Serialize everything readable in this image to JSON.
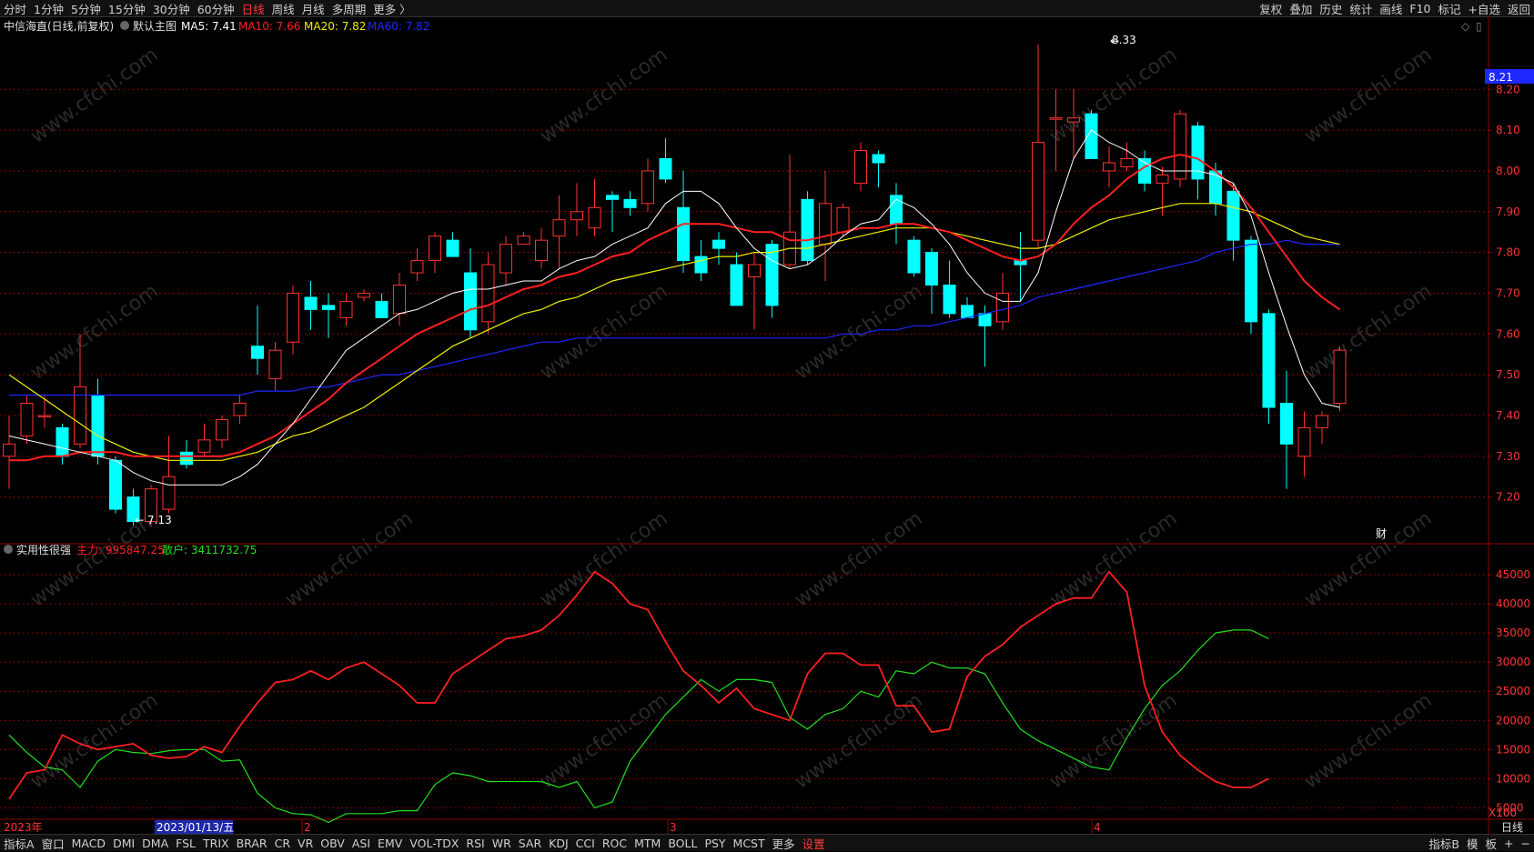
{
  "topbar": {
    "periods": [
      "分时",
      "1分钟",
      "5分钟",
      "15分钟",
      "30分钟",
      "60分钟",
      "日线",
      "周线",
      "月线",
      "多周期",
      "更多 〉"
    ],
    "active_period": "日线",
    "tools": [
      "复权",
      "叠加",
      "历史",
      "统计",
      "画线",
      "F10",
      "标记",
      "+自选",
      "返回"
    ]
  },
  "main_chart": {
    "title": "中信海直(日线,前复权)",
    "template": "默认主图",
    "ma5": "MA5: 7.41",
    "ma10": "MA10: 7.66",
    "ma20": "MA20: 7.82",
    "ma60": "MA60: 7.82",
    "current_price_tag": "8.21",
    "high_label": "8.33",
    "low_label": "7.13",
    "fin_badge": "财"
  },
  "sub_chart": {
    "title": "实用性很强",
    "zhuli": "主力: 995847.25",
    "sanhu": "散户: 3411732.75",
    "unit": "X100"
  },
  "time_axis": {
    "labels": [
      "2023年",
      "2023/01/13/五",
      "2",
      "3",
      "4"
    ],
    "period_label": "日线"
  },
  "botbar": {
    "indicators": [
      "指标A",
      "窗口",
      "MACD",
      "DMI",
      "DMA",
      "FSL",
      "TRIX",
      "BRAR",
      "CR",
      "VR",
      "OBV",
      "ASI",
      "EMV",
      "VOL-TDX",
      "RSI",
      "WR",
      "SAR",
      "KDJ",
      "CCI",
      "ROC",
      "MTM",
      "BOLL",
      "PSY",
      "MCST",
      "更多",
      "设置"
    ],
    "right": [
      "指标B",
      "模",
      "板",
      "+",
      "−"
    ]
  },
  "watermark": "www.cfchi.com",
  "colors": {
    "up": "#ff3232",
    "down": "#00ffff",
    "ma5": "#ffffff",
    "ma10": "#ff2020",
    "ma20": "#f0f000",
    "ma60": "#1e28ff",
    "zhuli": "#ff2020",
    "sanhu": "#20e020",
    "grid": "#8b0000"
  },
  "chart_data": [
    {
      "type": "candlestick",
      "title": "中信海直(日线,前复权)",
      "ylim": [
        7.13,
        8.33
      ],
      "yticks": [
        7.2,
        7.3,
        7.4,
        7.5,
        7.6,
        7.7,
        7.8,
        7.9,
        8.0,
        8.1,
        8.2
      ],
      "ohlc": [
        [
          7.3,
          7.33,
          7.22,
          7.4
        ],
        [
          7.35,
          7.43,
          7.33,
          7.45
        ],
        [
          7.4,
          7.4,
          7.37,
          7.45
        ],
        [
          7.37,
          7.3,
          7.28,
          7.38
        ],
        [
          7.33,
          7.47,
          7.32,
          7.6
        ],
        [
          7.45,
          7.3,
          7.28,
          7.49
        ],
        [
          7.29,
          7.17,
          7.16,
          7.3
        ],
        [
          7.2,
          7.14,
          7.13,
          7.22
        ],
        [
          7.14,
          7.22,
          7.13,
          7.23
        ],
        [
          7.17,
          7.25,
          7.16,
          7.35
        ],
        [
          7.31,
          7.28,
          7.27,
          7.34
        ],
        [
          7.31,
          7.34,
          7.3,
          7.38
        ],
        [
          7.34,
          7.39,
          7.32,
          7.4
        ],
        [
          7.4,
          7.43,
          7.38,
          7.45
        ],
        [
          7.57,
          7.54,
          7.5,
          7.67
        ],
        [
          7.49,
          7.56,
          7.46,
          7.58
        ],
        [
          7.58,
          7.7,
          7.55,
          7.72
        ],
        [
          7.69,
          7.66,
          7.61,
          7.73
        ],
        [
          7.67,
          7.66,
          7.59,
          7.7
        ],
        [
          7.64,
          7.68,
          7.62,
          7.7
        ],
        [
          7.69,
          7.7,
          7.68,
          7.71
        ],
        [
          7.68,
          7.64,
          7.64,
          7.7
        ],
        [
          7.65,
          7.72,
          7.62,
          7.75
        ],
        [
          7.75,
          7.78,
          7.73,
          7.81
        ],
        [
          7.78,
          7.84,
          7.75,
          7.85
        ],
        [
          7.83,
          7.79,
          7.79,
          7.85
        ],
        [
          7.75,
          7.61,
          7.59,
          7.81
        ],
        [
          7.63,
          7.77,
          7.6,
          7.8
        ],
        [
          7.75,
          7.82,
          7.72,
          7.84
        ],
        [
          7.82,
          7.84,
          7.82,
          7.85
        ],
        [
          7.78,
          7.83,
          7.76,
          7.86
        ],
        [
          7.84,
          7.88,
          7.76,
          7.94
        ],
        [
          7.88,
          7.9,
          7.84,
          7.97
        ],
        [
          7.86,
          7.91,
          7.84,
          7.98
        ],
        [
          7.94,
          7.93,
          7.85,
          7.95
        ],
        [
          7.93,
          7.91,
          7.89,
          7.95
        ],
        [
          7.92,
          8.0,
          7.9,
          8.03
        ],
        [
          8.03,
          7.98,
          7.97,
          8.08
        ],
        [
          7.91,
          7.78,
          7.75,
          8.0
        ],
        [
          7.79,
          7.75,
          7.73,
          7.83
        ],
        [
          7.83,
          7.81,
          7.77,
          7.85
        ],
        [
          7.77,
          7.67,
          7.67,
          7.8
        ],
        [
          7.74,
          7.77,
          7.61,
          7.8
        ],
        [
          7.82,
          7.67,
          7.64,
          7.83
        ],
        [
          7.77,
          7.85,
          7.76,
          8.04
        ],
        [
          7.93,
          7.78,
          7.77,
          7.95
        ],
        [
          7.82,
          7.92,
          7.73,
          8.0
        ],
        [
          7.85,
          7.91,
          7.84,
          7.92
        ],
        [
          7.97,
          8.05,
          7.95,
          8.07
        ],
        [
          8.04,
          8.02,
          7.96,
          8.05
        ],
        [
          7.94,
          7.87,
          7.82,
          7.97
        ],
        [
          7.83,
          7.75,
          7.74,
          7.84
        ],
        [
          7.8,
          7.72,
          7.65,
          7.81
        ],
        [
          7.72,
          7.65,
          7.64,
          7.78
        ],
        [
          7.67,
          7.64,
          7.65,
          7.69
        ],
        [
          7.65,
          7.62,
          7.52,
          7.67
        ],
        [
          7.63,
          7.7,
          7.61,
          7.75
        ],
        [
          7.78,
          7.77,
          7.68,
          7.85
        ],
        [
          7.83,
          8.07,
          7.81,
          8.31
        ],
        [
          8.13,
          8.13,
          8.0,
          8.2
        ],
        [
          8.12,
          8.13,
          8.03,
          8.2
        ],
        [
          8.14,
          8.03,
          8.03,
          8.15
        ],
        [
          8.0,
          8.02,
          7.96,
          8.06
        ],
        [
          8.01,
          8.03,
          8.0,
          8.07
        ],
        [
          8.03,
          7.97,
          7.95,
          8.05
        ],
        [
          7.97,
          7.99,
          7.89,
          8.01
        ],
        [
          7.98,
          8.14,
          7.96,
          8.15
        ],
        [
          8.11,
          7.98,
          7.93,
          8.12
        ],
        [
          8.0,
          7.92,
          7.89,
          8.02
        ],
        [
          7.95,
          7.83,
          7.78,
          7.97
        ],
        [
          7.83,
          7.63,
          7.6,
          7.84
        ],
        [
          7.65,
          7.42,
          7.38,
          7.66
        ],
        [
          7.43,
          7.33,
          7.22,
          7.51
        ],
        [
          7.3,
          7.37,
          7.25,
          7.41
        ],
        [
          7.37,
          7.4,
          7.33,
          7.41
        ],
        [
          7.43,
          7.56,
          7.41,
          7.57
        ]
      ],
      "ma5": [
        7.35,
        7.34,
        7.33,
        7.32,
        7.31,
        7.3,
        7.29,
        7.26,
        7.24,
        7.23,
        7.23,
        7.23,
        7.23,
        7.25,
        7.28,
        7.33,
        7.38,
        7.44,
        7.5,
        7.56,
        7.59,
        7.62,
        7.65,
        7.66,
        7.68,
        7.7,
        7.71,
        7.71,
        7.72,
        7.73,
        7.73,
        7.76,
        7.78,
        7.79,
        7.82,
        7.84,
        7.86,
        7.92,
        7.95,
        7.95,
        7.92,
        7.86,
        7.81,
        7.78,
        7.76,
        7.77,
        7.8,
        7.84,
        7.87,
        7.88,
        7.93,
        7.91,
        7.87,
        7.82,
        7.75,
        7.7,
        7.68,
        7.68,
        7.75,
        7.9,
        8.03,
        8.1,
        8.07,
        8.05,
        8.02,
        8.0,
        8.0,
        8.0,
        7.99,
        7.97,
        7.89,
        7.75,
        7.62,
        7.5,
        7.43,
        7.42
      ],
      "ma10": [
        7.29,
        7.29,
        7.3,
        7.3,
        7.31,
        7.31,
        7.31,
        7.3,
        7.3,
        7.3,
        7.3,
        7.3,
        7.3,
        7.31,
        7.33,
        7.35,
        7.38,
        7.41,
        7.44,
        7.48,
        7.51,
        7.54,
        7.57,
        7.6,
        7.62,
        7.64,
        7.66,
        7.67,
        7.69,
        7.71,
        7.72,
        7.74,
        7.75,
        7.77,
        7.79,
        7.8,
        7.83,
        7.85,
        7.87,
        7.87,
        7.87,
        7.86,
        7.85,
        7.85,
        7.83,
        7.83,
        7.84,
        7.85,
        7.86,
        7.86,
        7.87,
        7.87,
        7.86,
        7.85,
        7.83,
        7.81,
        7.79,
        7.78,
        7.79,
        7.82,
        7.87,
        7.91,
        7.94,
        7.98,
        8.01,
        8.03,
        8.04,
        8.03,
        8.0,
        7.96,
        7.91,
        7.85,
        7.79,
        7.73,
        7.69,
        7.66
      ],
      "ma20": [
        7.5,
        7.47,
        7.44,
        7.41,
        7.38,
        7.35,
        7.33,
        7.31,
        7.3,
        7.29,
        7.29,
        7.29,
        7.29,
        7.3,
        7.31,
        7.33,
        7.35,
        7.36,
        7.38,
        7.4,
        7.42,
        7.45,
        7.48,
        7.51,
        7.54,
        7.57,
        7.59,
        7.61,
        7.63,
        7.65,
        7.66,
        7.68,
        7.69,
        7.71,
        7.73,
        7.74,
        7.75,
        7.76,
        7.77,
        7.78,
        7.79,
        7.79,
        7.8,
        7.8,
        7.81,
        7.81,
        7.82,
        7.83,
        7.84,
        7.85,
        7.86,
        7.86,
        7.86,
        7.85,
        7.84,
        7.83,
        7.82,
        7.81,
        7.81,
        7.82,
        7.84,
        7.86,
        7.88,
        7.89,
        7.9,
        7.91,
        7.92,
        7.92,
        7.92,
        7.91,
        7.9,
        7.88,
        7.86,
        7.84,
        7.83,
        7.82
      ],
      "ma60": [
        7.45,
        7.45,
        7.45,
        7.45,
        7.45,
        7.45,
        7.45,
        7.45,
        7.45,
        7.45,
        7.45,
        7.45,
        7.45,
        7.45,
        7.46,
        7.46,
        7.46,
        7.47,
        7.47,
        7.48,
        7.49,
        7.5,
        7.5,
        7.51,
        7.52,
        7.53,
        7.54,
        7.55,
        7.56,
        7.57,
        7.58,
        7.58,
        7.59,
        7.59,
        7.59,
        7.59,
        7.59,
        7.59,
        7.59,
        7.59,
        7.59,
        7.59,
        7.59,
        7.59,
        7.59,
        7.59,
        7.59,
        7.6,
        7.6,
        7.61,
        7.61,
        7.62,
        7.62,
        7.63,
        7.64,
        7.65,
        7.66,
        7.67,
        7.69,
        7.7,
        7.71,
        7.72,
        7.73,
        7.74,
        7.75,
        7.76,
        7.77,
        7.78,
        7.8,
        7.81,
        7.82,
        7.82,
        7.83,
        7.82,
        7.82,
        7.82
      ]
    },
    {
      "type": "line",
      "title": "实用性很强",
      "unit": "X100",
      "ylim": [
        3500,
        47500
      ],
      "yticks": [
        5000,
        10000,
        15000,
        20000,
        25000,
        30000,
        35000,
        40000,
        45000
      ],
      "series": [
        {
          "name": "主力",
          "values": [
            6500,
            11000,
            11500,
            17500,
            16000,
            15000,
            15500,
            16000,
            14000,
            13500,
            13800,
            15500,
            14500,
            19000,
            23000,
            26500,
            27000,
            28500,
            27000,
            29000,
            30000,
            28000,
            26000,
            23000,
            23000,
            28000,
            30000,
            32000,
            34000,
            34500,
            35500,
            38000,
            41500,
            45500,
            43500,
            40000,
            39000,
            33500,
            28500,
            26000,
            23000,
            25500,
            22000,
            21000,
            20000,
            28000,
            31500,
            31500,
            29500,
            29500,
            22500,
            22500,
            18000,
            18500,
            27500,
            31000,
            33000,
            36000,
            38000,
            40000,
            41000,
            41000,
            45500,
            42000,
            26000,
            18000,
            14000,
            11500,
            9500,
            8500,
            8500,
            10000
          ]
        },
        {
          "name": "散户",
          "values": [
            17500,
            14500,
            12000,
            11500,
            8500,
            13000,
            15000,
            14500,
            14300,
            14800,
            15000,
            15000,
            13000,
            13200,
            7500,
            5000,
            4000,
            3800,
            2500,
            4000,
            4000,
            4000,
            4500,
            4500,
            9000,
            11000,
            10500,
            9500,
            9500,
            9500,
            9500,
            8500,
            9500,
            5000,
            6000,
            13000,
            17000,
            21000,
            24000,
            27000,
            25000,
            27000,
            27000,
            26500,
            20500,
            18500,
            21000,
            22000,
            25000,
            24000,
            28500,
            28000,
            30000,
            29000,
            29000,
            28000,
            23000,
            18500,
            16500,
            15000,
            13500,
            12000,
            11500,
            17000,
            22000,
            26000,
            28500,
            32000,
            35000,
            35500,
            35500,
            34000
          ]
        }
      ]
    }
  ]
}
